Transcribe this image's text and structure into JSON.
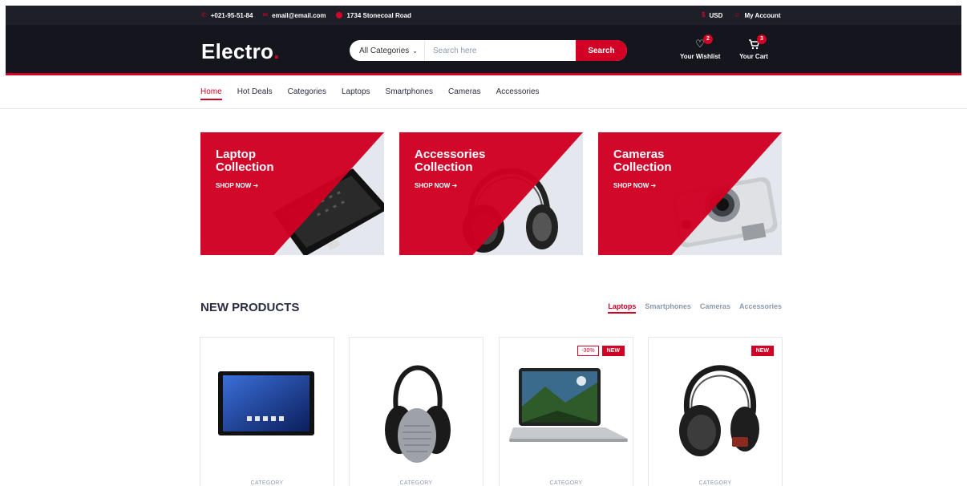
{
  "topbar": {
    "phone": "+021-95-51-84",
    "email": "email@email.com",
    "address": "1734 Stonecoal Road",
    "currency": "USD",
    "account": "My Account",
    "icons": [
      "phone-icon",
      "envelope-icon",
      "map-marker-icon",
      "dollar-icon",
      "user-icon"
    ]
  },
  "header": {
    "logo": "Electro",
    "logo_dot": ".",
    "search": {
      "category": "All Categories",
      "placeholder": "Search here",
      "button": "Search"
    },
    "wishlist": {
      "label": "Your Wishlist",
      "count": "2"
    },
    "cart": {
      "label": "Your Cart",
      "count": "3"
    }
  },
  "nav": {
    "items": [
      "Home",
      "Hot Deals",
      "Categories",
      "Laptops",
      "Smartphones",
      "Cameras",
      "Accessories"
    ],
    "active": "Home"
  },
  "collections": [
    {
      "title_line1": "Laptop",
      "title_line2": "Collection",
      "cta": "SHOP NOW",
      "image": "laptop"
    },
    {
      "title_line1": "Accessories",
      "title_line2": "Collection",
      "cta": "SHOP NOW",
      "image": "headphones"
    },
    {
      "title_line1": "Cameras",
      "title_line2": "Collection",
      "cta": "SHOP NOW",
      "image": "camera"
    }
  ],
  "new_products": {
    "title": "NEW PRODUCTS",
    "tabs": [
      "Laptops",
      "Smartphones",
      "Cameras",
      "Accessories"
    ],
    "active_tab": "Laptops",
    "products": [
      {
        "category": "CATEGORY",
        "image": "tablet",
        "sale": "",
        "new": ""
      },
      {
        "category": "CATEGORY",
        "image": "headphones",
        "sale": "",
        "new": ""
      },
      {
        "category": "CATEGORY",
        "image": "laptop",
        "sale": "-30%",
        "new": "NEW"
      },
      {
        "category": "CATEGORY",
        "image": "headphones",
        "sale": "",
        "new": "NEW"
      }
    ]
  },
  "colors": {
    "accent": "#D10024",
    "dark": "#15161D",
    "topbar": "#1E1F29",
    "text": "#2B2D42",
    "muted": "#8D99AE"
  }
}
